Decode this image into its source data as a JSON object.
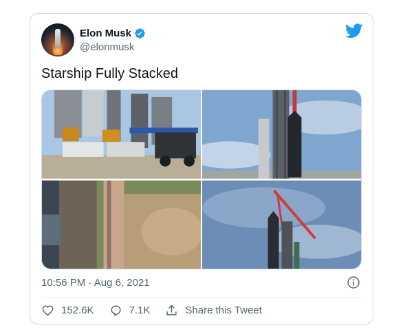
{
  "tweet": {
    "author_name": "Elon Musk",
    "author_handle": "@elonmusk",
    "text": "Starship Fully Stacked",
    "timestamp": "10:56 PM · Aug 6, 2021"
  },
  "actions": {
    "likes": "152.6K",
    "replies": "7.1K",
    "share_label": "Share this Tweet"
  },
  "icons": [
    "verified-badge-icon",
    "twitter-bird-icon",
    "heart-icon",
    "reply-icon",
    "share-icon",
    "info-icon"
  ],
  "colors": {
    "brand": "#1d9bf0",
    "text": "#0f1419",
    "secondary": "#536471",
    "border": "#cfd9de"
  }
}
